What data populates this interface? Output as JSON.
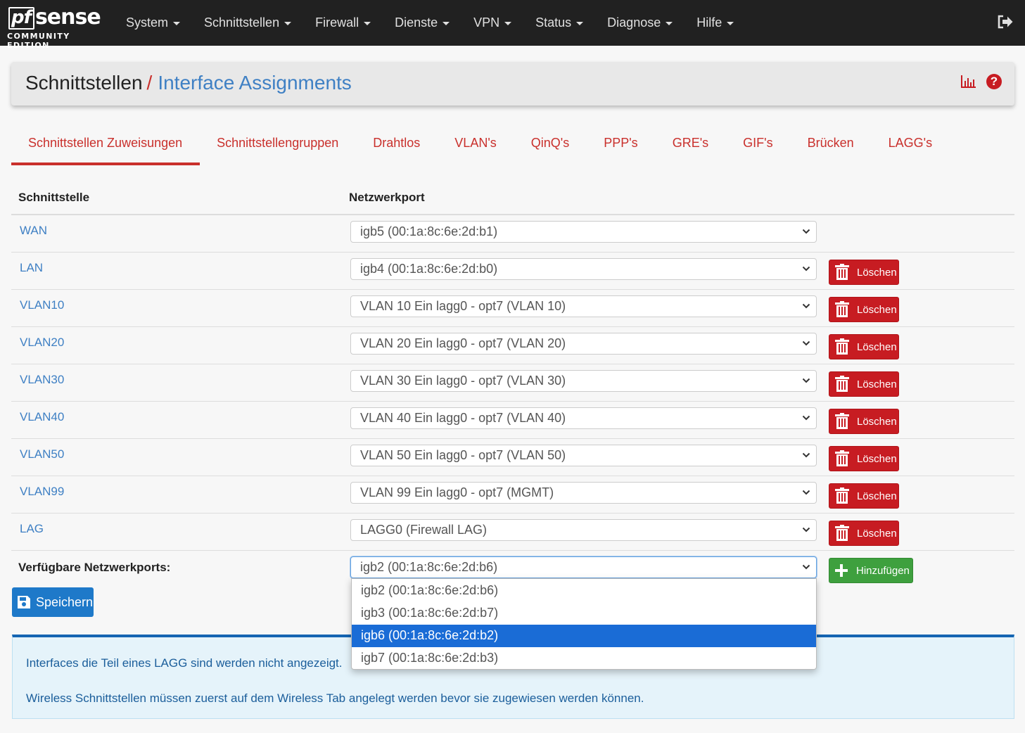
{
  "brand": {
    "logo_pf": "pf",
    "logo_sense": "sense",
    "edition": "COMMUNITY EDITION"
  },
  "nav": {
    "items": [
      {
        "label": "System"
      },
      {
        "label": "Schnittstellen"
      },
      {
        "label": "Firewall"
      },
      {
        "label": "Dienste"
      },
      {
        "label": "VPN"
      },
      {
        "label": "Status"
      },
      {
        "label": "Diagnose"
      },
      {
        "label": "Hilfe"
      }
    ],
    "logout_icon": "sign-out-icon"
  },
  "breadcrumb": {
    "root": "Schnittstellen",
    "separator": "/",
    "current": "Interface Assignments",
    "chart_icon": "bar-chart-icon",
    "help_icon": "question-circle-icon",
    "help_glyph": "?"
  },
  "tabs": [
    {
      "label": "Schnittstellen Zuweisungen",
      "active": true
    },
    {
      "label": "Schnittstellengruppen"
    },
    {
      "label": "Drahtlos"
    },
    {
      "label": "VLAN's"
    },
    {
      "label": "QinQ's"
    },
    {
      "label": "PPP's"
    },
    {
      "label": "GRE's"
    },
    {
      "label": "GIF's"
    },
    {
      "label": "Brücken"
    },
    {
      "label": "LAGG's"
    }
  ],
  "table": {
    "headers": {
      "interface": "Schnittstelle",
      "port": "Netzwerkport"
    },
    "rows": [
      {
        "name": "WAN",
        "port": "igb5 (00:1a:8c:6e:2d:b1)"
      },
      {
        "name": "LAN",
        "port": "igb4 (00:1a:8c:6e:2d:b0)"
      },
      {
        "name": "VLAN10",
        "port": "VLAN 10 Ein lagg0 - opt7 (VLAN 10)"
      },
      {
        "name": "VLAN20",
        "port": "VLAN 20 Ein lagg0 - opt7 (VLAN 20)"
      },
      {
        "name": "VLAN30",
        "port": "VLAN 30 Ein lagg0 - opt7 (VLAN 30)"
      },
      {
        "name": "VLAN40",
        "port": "VLAN 40 Ein lagg0 - opt7 (VLAN 40)"
      },
      {
        "name": "VLAN50",
        "port": "VLAN 50 Ein lagg0 - opt7 (VLAN 50)"
      },
      {
        "name": "VLAN99",
        "port": "VLAN 99 Ein lagg0 - opt7 (MGMT)"
      },
      {
        "name": "LAG",
        "port": "LAGG0 (Firewall LAG)"
      }
    ],
    "delete_label": "Löschen",
    "available_label": "Verfügbare Netzwerkports:",
    "available_value": "igb2 (00:1a:8c:6e:2d:b6)",
    "add_label": "Hinzufügen"
  },
  "dropdown": {
    "options": [
      {
        "label": "igb2 (00:1a:8c:6e:2d:b6)"
      },
      {
        "label": "igb3 (00:1a:8c:6e:2d:b7)"
      },
      {
        "label": "igb6 (00:1a:8c:6e:2d:b2)",
        "highlighted": true
      },
      {
        "label": "igb7 (00:1a:8c:6e:2d:b3)"
      }
    ]
  },
  "save_label": "Speichern",
  "info": {
    "line1": "Interfaces die Teil eines LAGG sind werden nicht angezeigt.",
    "line2": "Wireless Schnittstellen müssen zuerst auf dem Wireless Tab angelegt werden bevor sie zugewiesen werden können."
  },
  "colors": {
    "navbar": "#212121",
    "accent_red": "#c9302c",
    "link_blue": "#3f80c4",
    "delete_red": "#c71c22",
    "add_green": "#3ea03e",
    "save_blue": "#1e79c9",
    "highlight_blue": "#1a6cd6"
  }
}
